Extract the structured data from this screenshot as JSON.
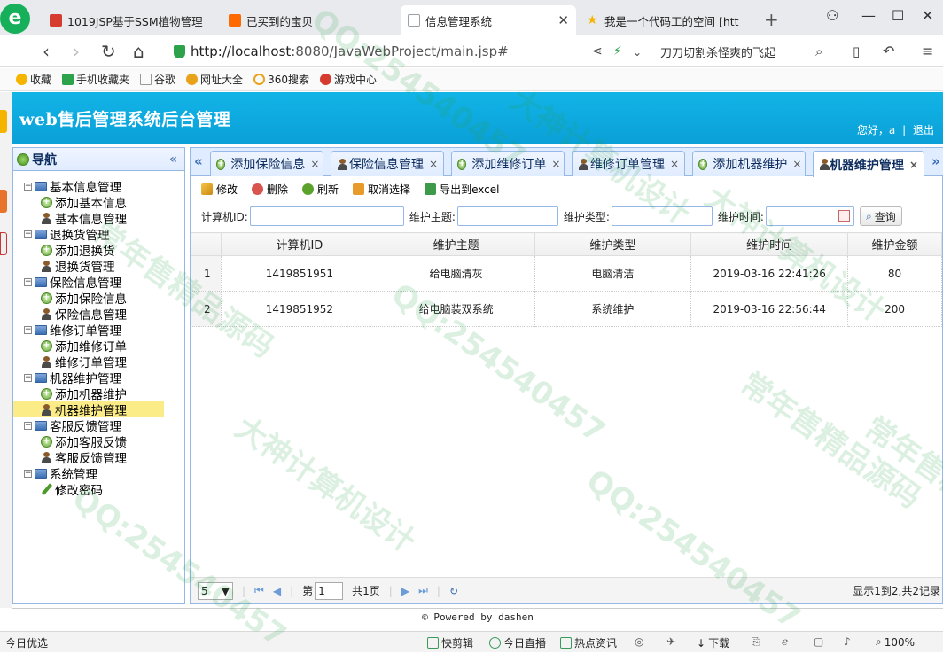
{
  "browser": {
    "tabs": [
      {
        "title": "1019JSP基于SSM植物管理",
        "color": "#d63b2f"
      },
      {
        "title": "已买到的宝贝",
        "color": "#ff6a00"
      },
      {
        "title": "信息管理系统",
        "color": "#9aa0a6"
      },
      {
        "title": "我是一个代码工的空间 [htt",
        "color": "#f5b400"
      }
    ],
    "url_host": "http://localhost",
    "url_path": ":8080/JavaWebProject/main.jsp#",
    "search_text": "刀刀切割杀怪爽的飞起",
    "bookmarks": [
      "收藏",
      "手机收藏夹",
      "谷歌",
      "网址大全",
      "360搜索",
      "游戏中心"
    ]
  },
  "app": {
    "title": "web售后管理系统后台管理",
    "greeting": "您好，a",
    "logout": "退出",
    "nav_title": "导航",
    "tree": [
      {
        "label": "基本信息管理",
        "children": [
          {
            "label": "添加基本信息",
            "icon": "add"
          },
          {
            "label": "基本信息管理",
            "icon": "user"
          }
        ]
      },
      {
        "label": "退换货管理",
        "children": [
          {
            "label": "添加退换货",
            "icon": "add"
          },
          {
            "label": "退换货管理",
            "icon": "user"
          }
        ]
      },
      {
        "label": "保险信息管理",
        "children": [
          {
            "label": "添加保险信息",
            "icon": "add"
          },
          {
            "label": "保险信息管理",
            "icon": "user"
          }
        ]
      },
      {
        "label": "维修订单管理",
        "children": [
          {
            "label": "添加维修订单",
            "icon": "add"
          },
          {
            "label": "维修订单管理",
            "icon": "user"
          }
        ]
      },
      {
        "label": "机器维护管理",
        "children": [
          {
            "label": "添加机器维护",
            "icon": "add"
          },
          {
            "label": "机器维护管理",
            "icon": "user",
            "selected": true
          }
        ]
      },
      {
        "label": "客服反馈管理",
        "children": [
          {
            "label": "添加客服反馈",
            "icon": "add"
          },
          {
            "label": "客服反馈管理",
            "icon": "user"
          }
        ]
      },
      {
        "label": "系统管理",
        "children": [
          {
            "label": "修改密码",
            "icon": "pencil"
          }
        ]
      }
    ],
    "tabs": [
      {
        "label": "添加保险信息",
        "icon": "add"
      },
      {
        "label": "保险信息管理",
        "icon": "user"
      },
      {
        "label": "添加维修订单",
        "icon": "add"
      },
      {
        "label": "维修订单管理",
        "icon": "user"
      },
      {
        "label": "添加机器维护",
        "icon": "add"
      },
      {
        "label": "机器维护管理",
        "icon": "user",
        "active": true
      }
    ],
    "toolbar": {
      "edit": "修改",
      "delete": "删除",
      "refresh": "刷新",
      "deselect": "取消选择",
      "export": "导出到excel"
    },
    "search": {
      "computer_id_label": "计算机ID:",
      "topic_label": "维护主题:",
      "type_label": "维护类型:",
      "time_label": "维护时间:",
      "button": "查询"
    },
    "grid": {
      "columns": [
        "计算机ID",
        "维护主题",
        "维护类型",
        "维护时间",
        "维护金额"
      ],
      "rows": [
        {
          "n": "1",
          "cells": [
            "1419851951",
            "给电脑清灰",
            "电脑清洁",
            "2019-03-16 22:41:26",
            "80"
          ]
        },
        {
          "n": "2",
          "cells": [
            "1419851952",
            "给电脑装双系统",
            "系统维护",
            "2019-03-16 22:56:44",
            "200"
          ]
        }
      ]
    },
    "pager": {
      "page_size": "5",
      "page_prefix": "第",
      "page": "1",
      "page_total": "共1页",
      "info": "显示1到2,共2记录"
    },
    "footer": "© Powered by dashen"
  },
  "statusbar": {
    "left": "今日优选",
    "items": [
      "快剪辑",
      "今日直播",
      "热点资讯",
      "下载",
      "100%"
    ]
  },
  "watermarks": [
    "QQ:254540457",
    "大神计算机设计",
    "常年售精品源码"
  ]
}
